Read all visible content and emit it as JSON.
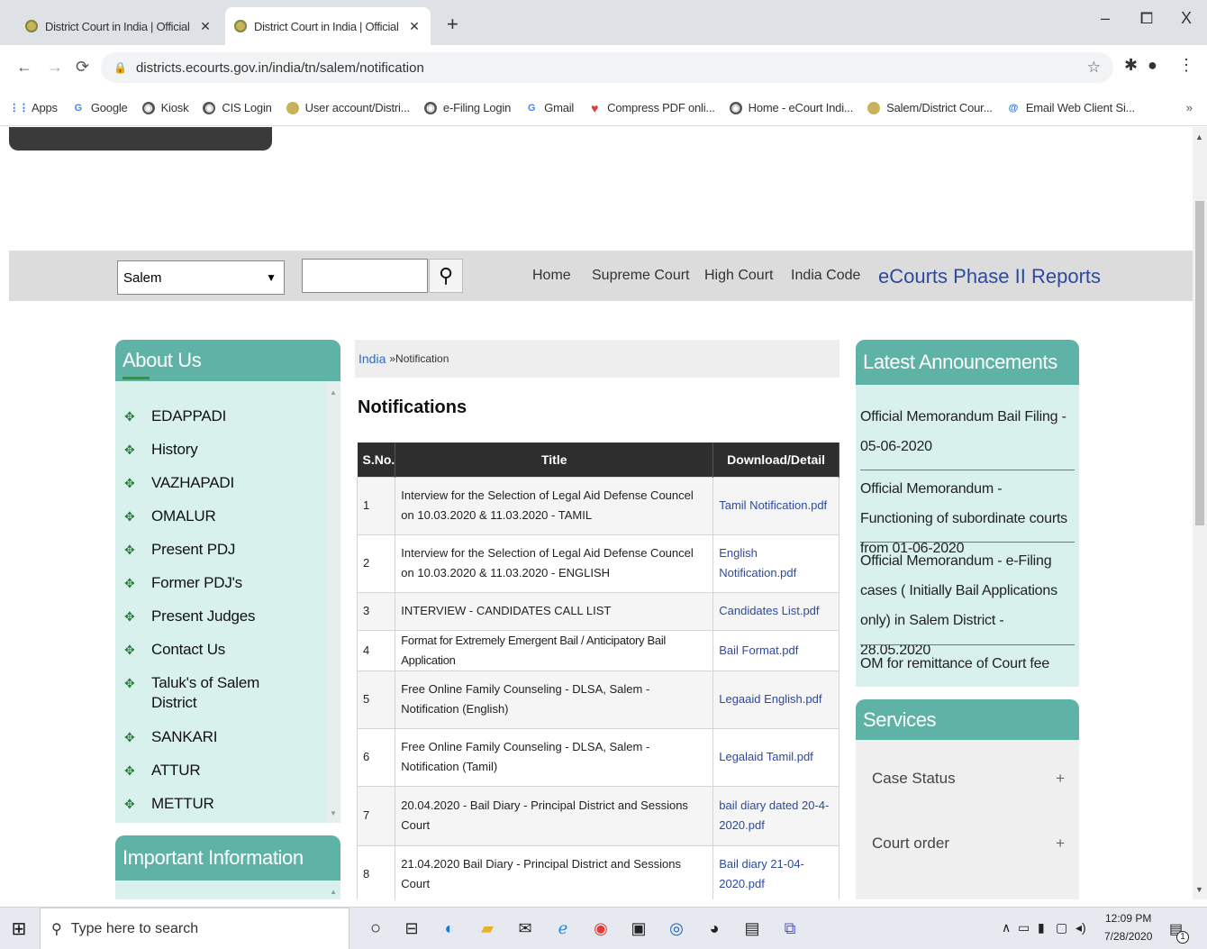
{
  "browser": {
    "tabs": [
      {
        "title": "District Court in India | Official W",
        "active": false
      },
      {
        "title": "District Court in India | Official W",
        "active": true
      }
    ],
    "new_tab": "+",
    "minimize": "–",
    "restore": "⧠",
    "close": "X",
    "url": "districts.ecourts.gov.in/india/tn/salem/notification",
    "bookmarks": [
      {
        "label": "Apps",
        "icon": "apps-icon"
      },
      {
        "label": "Google",
        "icon": "google-icon"
      },
      {
        "label": "Kiosk",
        "icon": "globe-icon"
      },
      {
        "label": "CIS Login",
        "icon": "globe-icon"
      },
      {
        "label": "User account/Distri...",
        "icon": "emblem-icon"
      },
      {
        "label": "e-Filing Login",
        "icon": "globe-icon"
      },
      {
        "label": "Gmail",
        "icon": "google-icon"
      },
      {
        "label": "Compress PDF onli...",
        "icon": "heart-icon"
      },
      {
        "label": "Home - eCourt Indi...",
        "icon": "globe-icon"
      },
      {
        "label": "Salem/District Cour...",
        "icon": "emblem-icon"
      },
      {
        "label": "Email Web Client Si...",
        "icon": "email-icon"
      }
    ],
    "bookmarks_more": "»"
  },
  "topnav": {
    "district_select": "Salem",
    "links": [
      "Home",
      "Supreme Court",
      "High Court",
      "India Code"
    ],
    "reports_link": "eCourts Phase II Reports"
  },
  "about": {
    "heading": "About Us",
    "items": [
      "EDAPPADI",
      "History",
      "VAZHAPADI",
      "OMALUR",
      "Present PDJ",
      "Former PDJ's",
      "Present Judges",
      "Contact Us",
      "Taluk's of Salem District",
      "SANKARI",
      "ATTUR",
      "METTUR"
    ]
  },
  "important": {
    "heading": "Important Information"
  },
  "breadcrumb": {
    "root": "India",
    "separator": "»",
    "current": "Notification"
  },
  "notifications": {
    "heading": "Notifications",
    "columns": [
      "S.No.",
      "Title",
      "Download/Detail"
    ],
    "rows": [
      {
        "sn": "1",
        "title": "Interview for the Selection of Legal Aid Defense Councel on 10.03.2020 & 11.03.2020 - TAMIL",
        "file": "Tamil Notification.pdf"
      },
      {
        "sn": "2",
        "title": "Interview for the Selection of Legal Aid Defense Councel on 10.03.2020 & 11.03.2020 - ENGLISH",
        "file": "English Notification.pdf"
      },
      {
        "sn": "3",
        "title": "INTERVIEW - CANDIDATES CALL LIST",
        "file": "Candidates List.pdf"
      },
      {
        "sn": "4",
        "title": "Format for Extremely Emergent Bail / Anticipatory Bail Application",
        "file": "Bail Format.pdf"
      },
      {
        "sn": "5",
        "title": "Free Online Family Counseling - DLSA, Salem - Notification (English)",
        "file": "Legaaid English.pdf"
      },
      {
        "sn": "6",
        "title": "Free Online Family Counseling - DLSA, Salem - Notification (Tamil)",
        "file": "Legalaid Tamil.pdf"
      },
      {
        "sn": "7",
        "title": "20.04.2020 - Bail Diary - Principal District and Sessions Court",
        "file": "bail diary dated 20-4-2020.pdf"
      },
      {
        "sn": "8",
        "title": "21.04.2020 Bail Diary - Principal District and Sessions Court",
        "file": "Bail diary 21-04-2020.pdf"
      }
    ]
  },
  "announcements": {
    "heading": "Latest Announcements",
    "items": [
      "Official Memorandum Bail Filing - 05-06-2020",
      "Official Memorandum - Functioning of subordinate courts from 01-06-2020",
      "Official Memorandum - e-Filing cases ( Initially Bail Applications only) in Salem District - 28.05.2020",
      "OM for remittance of Court fee through"
    ]
  },
  "services": {
    "heading": "Services",
    "items": [
      "Case Status",
      "Court order"
    ],
    "expand": "+"
  },
  "taskbar": {
    "search_placeholder": "Type here to search",
    "time": "12:09 PM",
    "date": "7/28/2020",
    "notification_count": "1"
  }
}
